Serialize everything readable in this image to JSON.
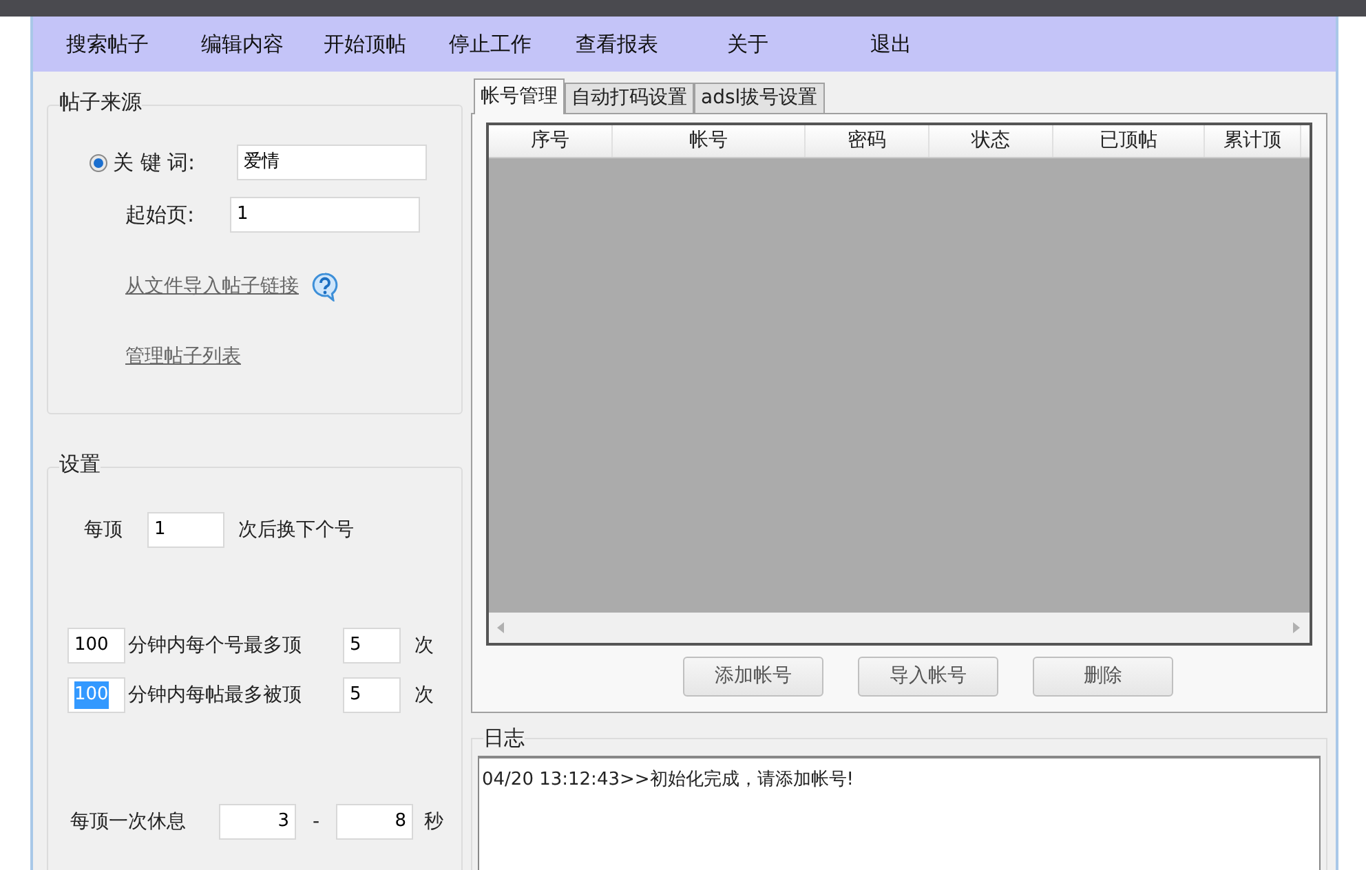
{
  "menu": [
    {
      "label": "搜索帖子"
    },
    {
      "label": "编辑内容"
    },
    {
      "label": "开始顶帖"
    },
    {
      "label": "停止工作"
    },
    {
      "label": "查看报表"
    },
    {
      "label": "关于"
    },
    {
      "label": "退出"
    }
  ],
  "post_source": {
    "title": "帖子来源",
    "keyword": {
      "label": "关 键 词:",
      "value": "爱情",
      "selected": true
    },
    "start_page": {
      "label": "起始页:",
      "value": "1"
    },
    "links": [
      "从文件导入帖子链接",
      "管理帖子列表"
    ]
  },
  "settings": {
    "title": "设置",
    "per_top": {
      "label": "每顶",
      "value": "1",
      "suffix": "次后换下个号"
    },
    "limits": [
      {
        "minutes": "100",
        "highlighted": false,
        "label": "分钟内每个号最多顶",
        "count": "5",
        "unit": "次"
      },
      {
        "minutes": "100",
        "highlighted": true,
        "label": "分钟内每帖最多被顶",
        "count": "5",
        "unit": "次"
      }
    ],
    "rest": {
      "label": "每顶一次休息",
      "min": "3",
      "separator": "-",
      "max": "8",
      "unit": "秒"
    }
  },
  "tabs": [
    {
      "label": "帐号管理",
      "selected": true
    },
    {
      "label": "自动打码设置",
      "selected": false
    },
    {
      "label": "adsl拔号设置",
      "selected": false
    }
  ],
  "table": {
    "columns": [
      "序号",
      "帐号",
      "密码",
      "状态",
      "已顶帖",
      "累计顶"
    ]
  },
  "buttons": [
    "添加帐号",
    "导入帐号",
    "删除"
  ],
  "log": {
    "title": "日志",
    "lines": [
      "04/20 13:12:43>>初始化完成，请添加帐号!"
    ]
  }
}
